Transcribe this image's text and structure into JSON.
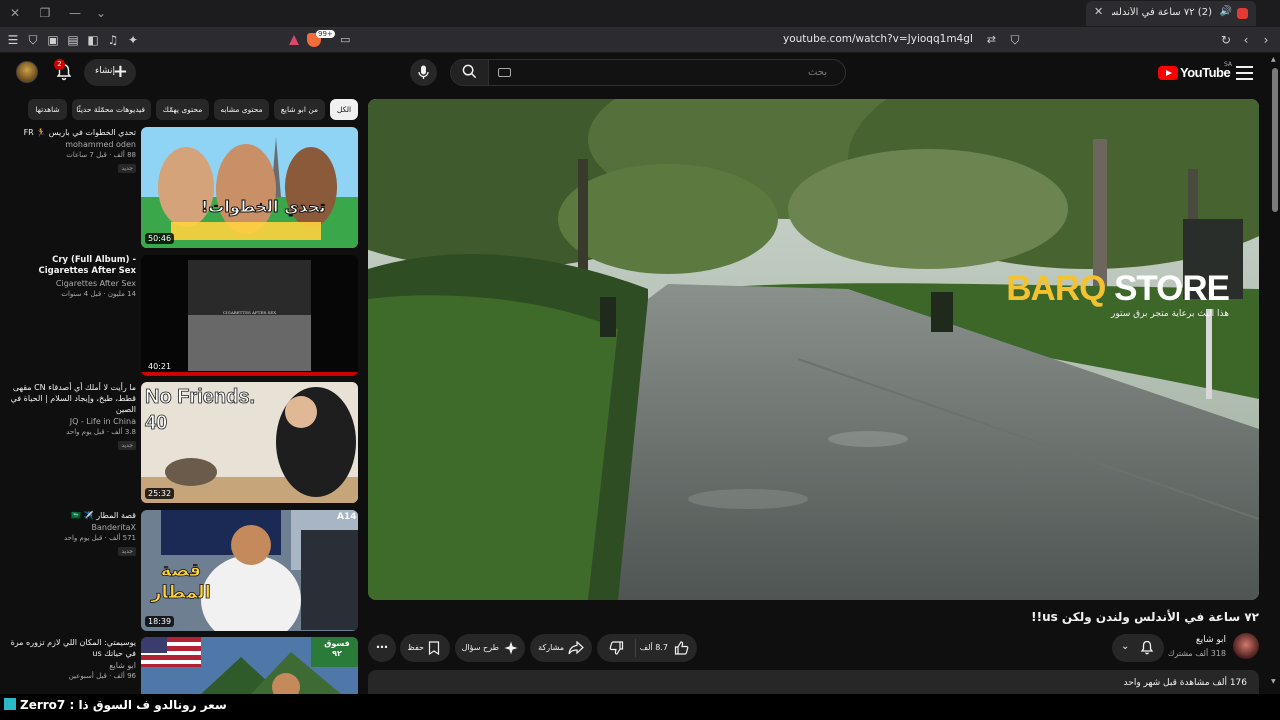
{
  "browser": {
    "tab_title": "(2) ٧٢ ساعة في الأندلس ولندن",
    "url": "youtube.com/watch?v=Jyioqq1m4gI",
    "shield_count": "99+"
  },
  "masthead": {
    "logo_text": "YouTube",
    "country_code": "SA",
    "search_placeholder": "بحث",
    "create_label": "إنشاء",
    "notification_count": "2"
  },
  "player": {
    "watermark_brand_1": "BARQ",
    "watermark_brand_2": "STORE",
    "watermark_tagline": "هذا البث برعاية متجر برق ستور"
  },
  "video": {
    "title": "٧٢ ساعة في الأندلس ولندن ولكن us!!",
    "channel_name": "ابو شايع",
    "channel_subs": "318 ألف مشترك",
    "likes": "8.7 ألف",
    "share_label": "مشاركة",
    "ask_label": "طرح سؤال",
    "save_label": "حفظ",
    "meta": "176 ألف مشاهدة قبل شهر واحد"
  },
  "chips": [
    {
      "label": "الكل",
      "active": true
    },
    {
      "label": "من ابو شايع"
    },
    {
      "label": "محتوى مشابه"
    },
    {
      "label": "محتوى يهمّك"
    },
    {
      "label": "فيديوهات محمّلة حديثًا"
    },
    {
      "label": "شاهدتها"
    }
  ],
  "recommendations": [
    {
      "title": "تحدي الخطوات في باريس 🏃 FR",
      "channel": "mohammed oden",
      "meta": "88 ألف · قبل 7 ساعات",
      "badge": "جديد",
      "duration": "50:46",
      "thumb_text": "تحدي الخطوات!"
    },
    {
      "title": "Cry (Full Album) - Cigarettes After Sex",
      "channel": "Cigarettes After Sex",
      "meta": "14 مليون · قبل 4 سنوات",
      "badge": "",
      "duration": "40:21",
      "thumb_text": "CIGARETTES AFTER SEX"
    },
    {
      "title": "ما رأيت لا أملك أي أصدقاء CN مقهى قطط، طبخ، وإيجاد السلام | الحياة في الصين",
      "channel": "JQ - Life in China",
      "meta": "3.8 ألف · قبل يوم واحد",
      "badge": "جديد",
      "duration": "25:32",
      "thumb_text_1": "No Friends.",
      "thumb_text_2": "40"
    },
    {
      "title": "قصة المطار ✈️ 🇸🇦",
      "channel": "BanderitaX",
      "meta": "571 ألف · قبل يوم واحد",
      "badge": "جديد",
      "duration": "18:39",
      "thumb_text": "قصة المطار",
      "thumb_sign": "A14"
    },
    {
      "title": "يوسيمتي: المكان اللي لازم تزوره مرة في حياتك us",
      "channel": "ابو شايع",
      "meta": "96 ألف · قبل أسبوعين",
      "badge": "",
      "duration": "",
      "thumb_text": "فسوق ٩٢"
    }
  ],
  "overlay": {
    "text": "Zerro7 : سعر رونالدو ف السوق ذا"
  }
}
